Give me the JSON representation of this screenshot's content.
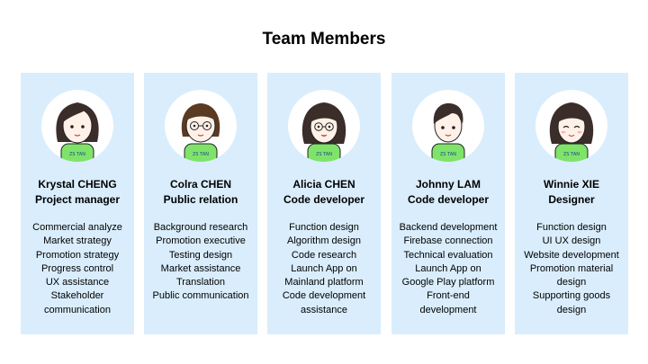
{
  "page": {
    "title": "Team Members"
  },
  "shirt_label": "ZS TAN",
  "colors": {
    "card": "#d9edfc",
    "shirt": "#7fe36a",
    "hair": "#3a2d2a",
    "hair_brown": "#5a3a22"
  },
  "members": [
    {
      "name": "Krystal CHENG",
      "role": "Project manager",
      "avatar": "girl-long-hair-avatar",
      "duties": [
        "Commercial analyze",
        "Market strategy",
        "Promotion strategy",
        "Progress control",
        "UX assistance",
        "Stakeholder",
        "communication"
      ]
    },
    {
      "name": "Colra CHEN",
      "role": "Public relation",
      "avatar": "girl-glasses-brown-hair-avatar",
      "duties": [
        "Background research",
        "Promotion executive",
        "Testing design",
        "Market assistance",
        "Translation",
        "Public communication"
      ]
    },
    {
      "name": "Alicia CHEN",
      "role": "Code developer",
      "avatar": "girl-glasses-long-hair-avatar",
      "duties": [
        "Function design",
        "Algorithm design",
        "Code research",
        "Launch App on",
        "Mainland platform",
        "Code development",
        "assistance"
      ]
    },
    {
      "name": "Johnny LAM",
      "role": "Code developer",
      "avatar": "boy-short-hair-avatar",
      "duties": [
        "Backend development",
        "Firebase connection",
        "Technical evaluation",
        "Launch App on",
        "Google Play platform",
        "Front-end",
        "development"
      ]
    },
    {
      "name": "Winnie XIE",
      "role": "Designer",
      "avatar": "girl-smiling-avatar",
      "duties": [
        "Function design",
        "UI UX design",
        "Website development",
        "Promotion material",
        "design",
        "Supporting goods",
        "design"
      ]
    }
  ]
}
